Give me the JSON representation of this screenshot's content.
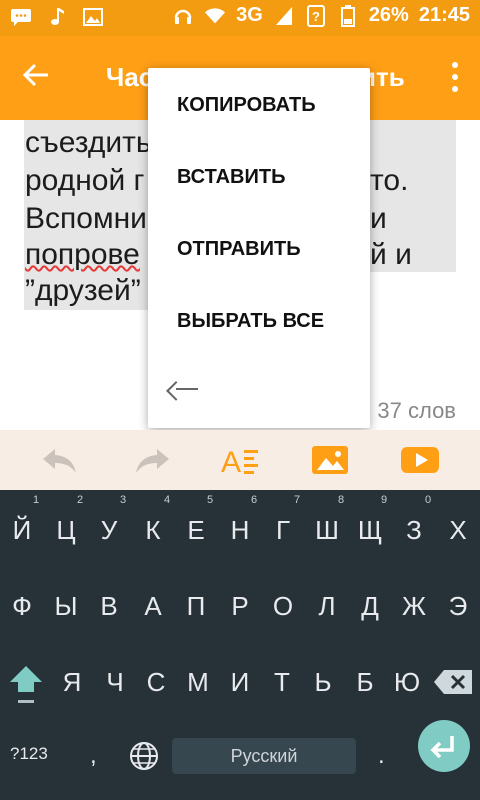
{
  "status_bar": {
    "network": "3G",
    "battery_percent": "26%",
    "time": "21:45",
    "icons": [
      "chat-icon",
      "music-icon",
      "image-icon",
      "headset-icon",
      "wifi-icon",
      "signal-icon",
      "unknown-icon",
      "battery-icon"
    ]
  },
  "toolbar": {
    "title_start": "Час",
    "title_end": "ить",
    "icons": [
      "arrow-back-icon",
      "more-vertical-icon"
    ]
  },
  "editor": {
    "lines": [
      "съездить",
      "родной г",
      "Вспомни",
      "попрове",
      "”друзей”"
    ],
    "right_fragments": [
      "то.",
      "и",
      "й и"
    ],
    "word_count": "37 слов"
  },
  "context_menu": {
    "items": [
      "КОПИРОВАТЬ",
      "ВСТАВИТЬ",
      "ОТПРАВИТЬ",
      "ВЫБРАТЬ ВСЕ"
    ],
    "back_icon": "arrow-left-icon"
  },
  "format_bar": {
    "icons": [
      "undo-icon",
      "redo-icon",
      "text-format-icon",
      "image-insert-icon",
      "video-insert-icon"
    ],
    "colors": {
      "accent": "#ff9f16",
      "disabled": "#c8c0b8"
    }
  },
  "keyboard": {
    "row1": [
      "Й",
      "Ц",
      "У",
      "К",
      "Е",
      "Н",
      "Г",
      "Ш",
      "Щ",
      "З",
      "Х"
    ],
    "row1_hints": [
      "1",
      "2",
      "3",
      "4",
      "5",
      "6",
      "7",
      "8",
      "9",
      "0"
    ],
    "row2": [
      "Ф",
      "Ы",
      "В",
      "А",
      "П",
      "Р",
      "О",
      "Л",
      "Д",
      "Ж",
      "Э"
    ],
    "row3": [
      "Я",
      "Ч",
      "С",
      "М",
      "И",
      "Т",
      "Ь",
      "Б",
      "Ю"
    ],
    "mode_key": "?123",
    "comma": ",",
    "period": ".",
    "space_label": "Русский",
    "icons": [
      "shift-icon",
      "backspace-icon",
      "globe-icon",
      "enter-icon"
    ]
  }
}
